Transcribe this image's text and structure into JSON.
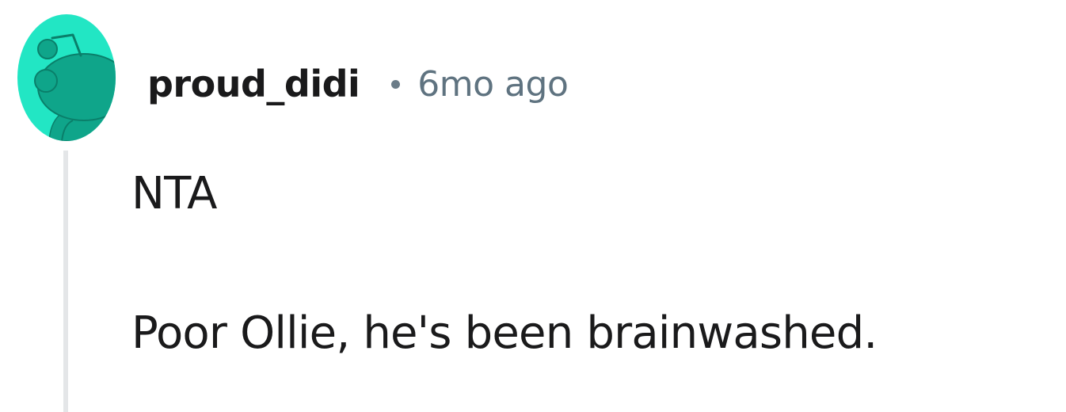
{
  "comment": {
    "author": "proud_didi",
    "separator": "•",
    "timestamp": "6mo ago",
    "avatar_icon": "reddit-snoo-avatar-icon",
    "body_lines": [
      "NTA",
      "Poor Ollie, he's been brainwashed."
    ]
  },
  "colors": {
    "avatar_background": "#22e6c4",
    "avatar_figure": "#0fa58a",
    "username": "#1a1a1b",
    "timestamp": "#5f7380",
    "thread_line": "#e4e6e8",
    "body_text": "#1a1a1b"
  }
}
